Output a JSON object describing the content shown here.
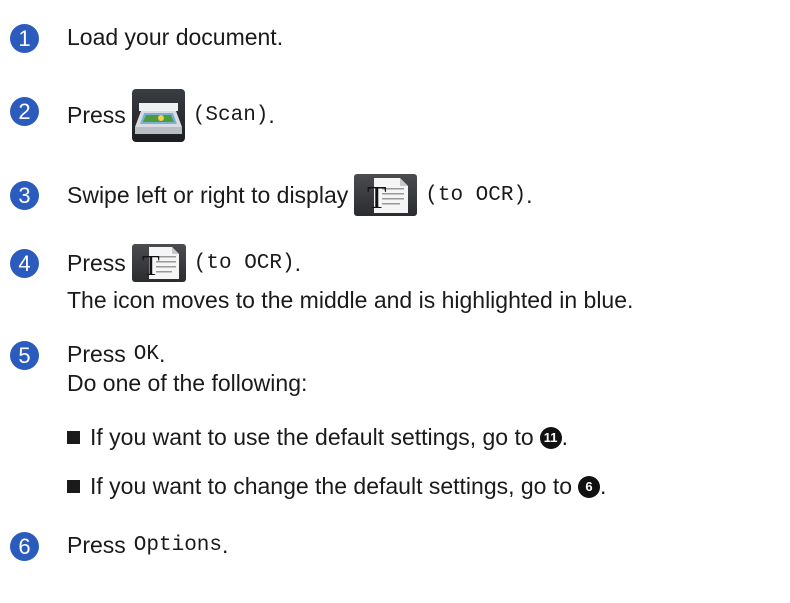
{
  "steps": [
    {
      "num": "1",
      "text": "Load your document."
    },
    {
      "num": "2",
      "before": "Press",
      "icon": "scan-icon",
      "code": "(Scan)",
      "after": "."
    },
    {
      "num": "3",
      "before": "Swipe left or right to display",
      "icon": "ocr-icon",
      "code": "(to OCR)",
      "after": "."
    },
    {
      "num": "4",
      "before": "Press",
      "icon": "ocr-icon",
      "code": "(to OCR)",
      "after": ".",
      "line2": "The icon moves to the middle and is highlighted in blue."
    },
    {
      "num": "5",
      "before": "Press",
      "code": "OK",
      "after": ".",
      "line2": "Do one of the following:",
      "bullets": [
        {
          "text": "If you want to use the default settings, go to",
          "ref": "11",
          "after": "."
        },
        {
          "text": "If you want to change the default settings, go to",
          "ref": "6",
          "after": "."
        }
      ]
    },
    {
      "num": "6",
      "before": "Press",
      "code": "Options",
      "after": "."
    }
  ],
  "colors": {
    "step_badge": "#2b5bbd",
    "text": "#1a1a1a"
  }
}
